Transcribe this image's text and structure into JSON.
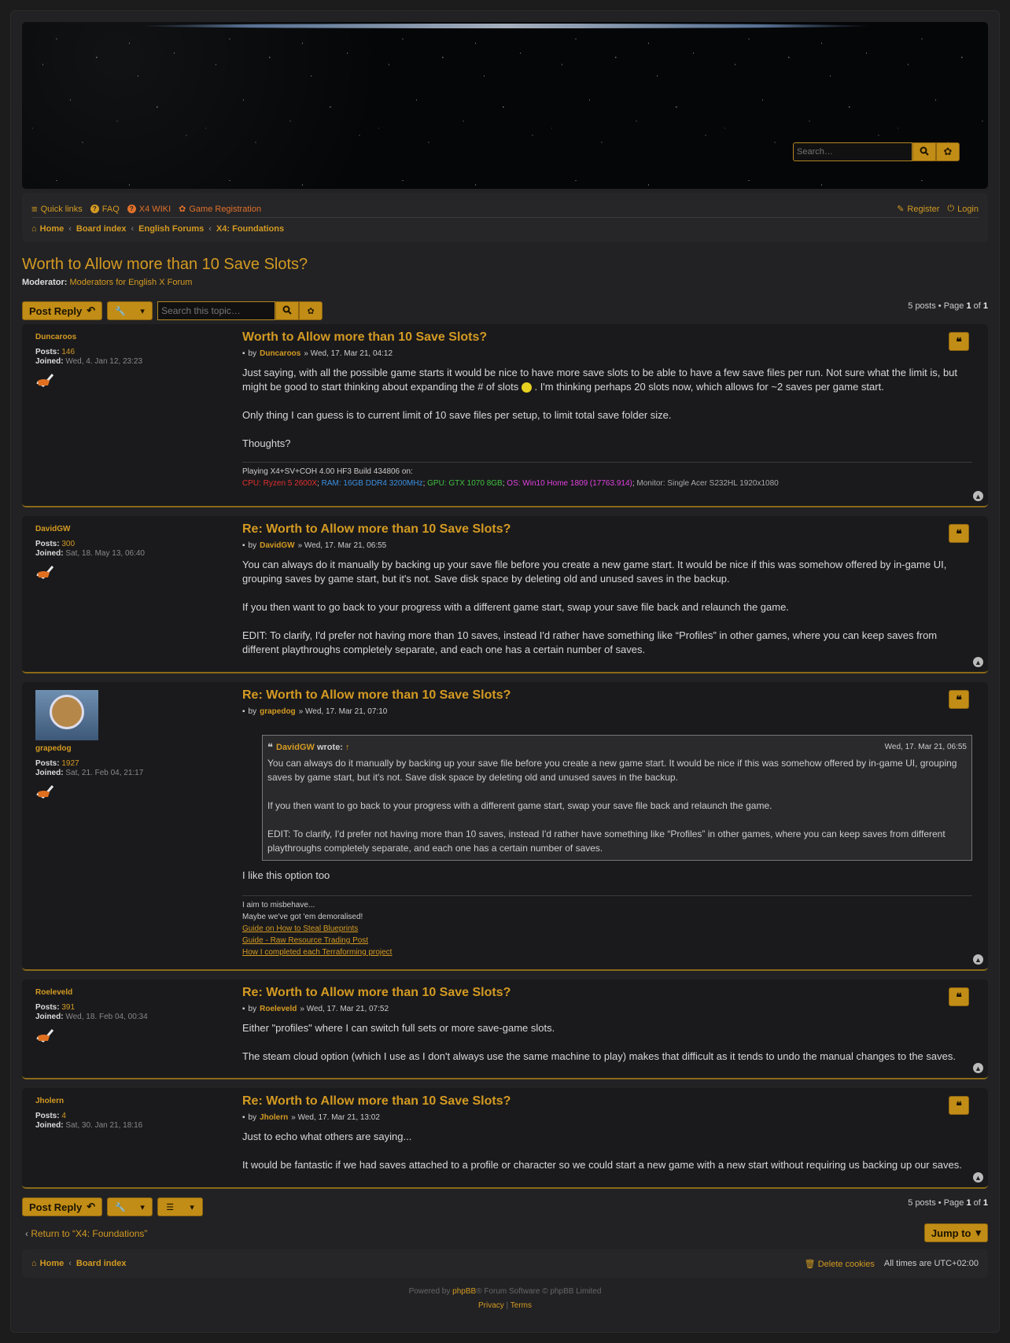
{
  "header": {
    "search_placeholder": "Search…",
    "search_icon": "search-icon",
    "adv_icon": "gear-icon"
  },
  "nav": {
    "quick_links": "Quick links",
    "faq": "FAQ",
    "wiki": "X4 WIKI",
    "game_reg": "Game Registration",
    "register": "Register",
    "login": "Login"
  },
  "breadcrumb": [
    "Home",
    "Board index",
    "English Forums",
    "X4: Foundations"
  ],
  "topic": {
    "title": "Worth to Allow more than 10 Save Slots?",
    "moderator_label": "Moderator:",
    "moderator": "Moderators for English X Forum"
  },
  "actions": {
    "post_reply": "Post Reply",
    "search_placeholder": "Search this topic…"
  },
  "pagination": {
    "pre": "5 posts • Page ",
    "page": "1",
    "of": " of ",
    "total": "1"
  },
  "posts": [
    {
      "author": "Duncaroos",
      "posts_label": "Posts:",
      "posts": "146",
      "joined_label": "Joined:",
      "joined": "Wed, 4. Jan 12, 23:23",
      "title": "Worth to Allow more than 10 Save Slots?",
      "by": "by",
      "date": "» Wed, 17. Mar 21, 04:12",
      "p1": "Just saying, with all the possible game starts it would be nice to have more save slots to be able to have a few save files per run. Not sure what the limit is, but might be good to start thinking about expanding the # of slots ",
      "p1b": " . I'm thinking perhaps 20 slots now, which allows for ~2 saves per game start.",
      "p2": "Only thing I can guess is to current limit of 10 save files per setup, to limit total save folder size.",
      "p3": "Thoughts?",
      "sig_line": "Playing X4+SV+COH 4.00 HF3 Build 434806 on:",
      "sig_cpu": "CPU: Ryzen 5 2600X",
      "sig_ram": "RAM: 16GB DDR4 3200MHz",
      "sig_gpu": "GPU: GTX 1070 8GB",
      "sig_os": "OS: Win10 Home 1809 (17763.914)",
      "sig_mon": "Monitor: Single Acer S232HL 1920x1080"
    },
    {
      "author": "DavidGW",
      "posts_label": "Posts:",
      "posts": "300",
      "joined_label": "Joined:",
      "joined": "Sat, 18. May 13, 06:40",
      "title": "Re: Worth to Allow more than 10 Save Slots?",
      "by": "by",
      "date": "» Wed, 17. Mar 21, 06:55",
      "p1": "You can always do it manually by backing up your save file before you create a new game start. It would be nice if this was somehow offered by in-game UI, grouping saves by game start, but it's not. Save disk space by deleting old and unused saves in the backup.",
      "p2": "If you then want to go back to your progress with a different game start, swap your save file back and relaunch the game.",
      "p3": "EDIT: To clarify, I'd prefer not having more than 10 saves, instead I'd rather have something like “Profiles” in other games, where you can keep saves from different playthroughs completely separate, and each one has a certain number of saves."
    },
    {
      "author": "grapedog",
      "posts_label": "Posts:",
      "posts": "1927",
      "joined_label": "Joined:",
      "joined": "Sat, 21. Feb 04, 21:17",
      "title": "Re: Worth to Allow more than 10 Save Slots?",
      "by": "by",
      "date": "» Wed, 17. Mar 21, 07:10",
      "quote_author": "DavidGW",
      "quote_wrote": "wrote:",
      "quote_arrow": "↑",
      "quote_date": "Wed, 17. Mar 21, 06:55",
      "q1": "You can always do it manually by backing up your save file before you create a new game start. It would be nice if this was somehow offered by in-game UI, grouping saves by game start, but it's not. Save disk space by deleting old and unused saves in the backup.",
      "q2": "If you then want to go back to your progress with a different game start, swap your save file back and relaunch the game.",
      "q3": "EDIT: To clarify, I'd prefer not having more than 10 saves, instead I'd rather have something like “Profiles” in other games, where you can keep saves from different playthroughs completely separate, and each one has a certain number of saves.",
      "p1": "I like this option too",
      "sig1": "I aim to misbehave...",
      "sig2": "Maybe we've got 'em demoralised!",
      "link1": "Guide on How to Steal Blueprints",
      "link2": "Guide - Raw Resource Trading Post",
      "link3": "How I completed each Terraforming project"
    },
    {
      "author": "Roeleveld",
      "posts_label": "Posts:",
      "posts": "391",
      "joined_label": "Joined:",
      "joined": "Wed, 18. Feb 04, 00:34",
      "title": "Re: Worth to Allow more than 10 Save Slots?",
      "by": "by",
      "date": "» Wed, 17. Mar 21, 07:52",
      "p1": "Either \"profiles\" where I can switch full sets or more save-game slots.",
      "p2": "The steam cloud option (which I use as I don't always use the same machine to play) makes that difficult as it tends to undo the manual changes to the saves."
    },
    {
      "author": "Jholern",
      "posts_label": "Posts:",
      "posts": "4",
      "joined_label": "Joined:",
      "joined": "Sat, 30. Jan 21, 18:16",
      "title": "Re: Worth to Allow more than 10 Save Slots?",
      "by": "by",
      "date": "» Wed, 17. Mar 21, 13:02",
      "p1": "Just to echo what others are saying...",
      "p2": "It would be fantastic if we had saves attached to a profile or character so we could start a new game with a new start without requiring us backing up our saves."
    }
  ],
  "bottom": {
    "return": "Return to “X4: Foundations”",
    "jump": "Jump to"
  },
  "footer": {
    "home": "Home",
    "board": "Board index",
    "delete_cookies": "Delete cookies",
    "times": "All times are ",
    "tz": "UTC+02:00",
    "powered_pre": "Powered by ",
    "phpbb": "phpBB",
    "powered_post": "® Forum Software © phpBB Limited",
    "privacy": "Privacy",
    "sep": " | ",
    "terms": "Terms"
  },
  "colors": {
    "accent": "#d49a22",
    "button": "#c28d16",
    "cpu": "#e03030",
    "ram": "#3a8fe0",
    "gpu": "#40c040",
    "os": "#e040e0"
  }
}
